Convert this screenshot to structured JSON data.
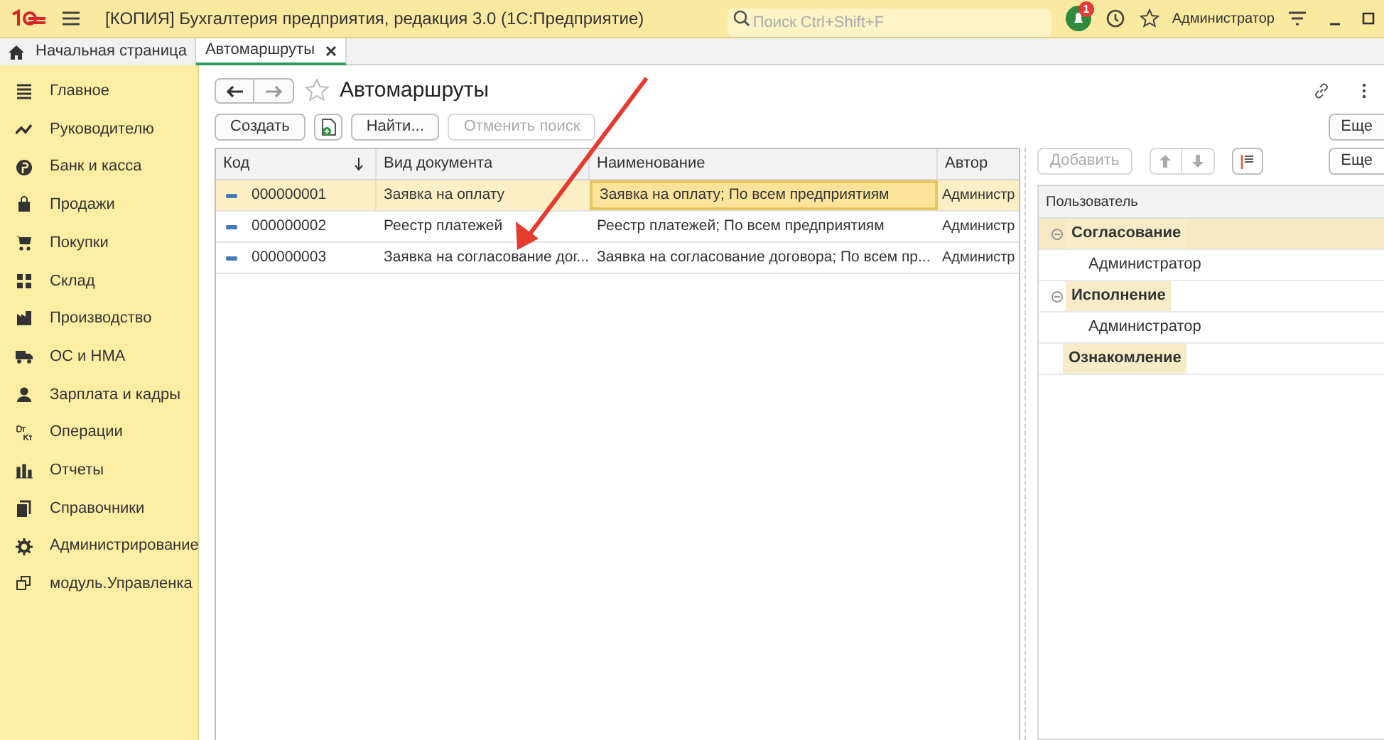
{
  "window": {
    "title": "[КОПИЯ] Бухгалтерия предприятия, редакция 3.0  (1С:Предприятие)",
    "search_placeholder": "Поиск Ctrl+Shift+F",
    "notification_count": "1",
    "user": "Администратор"
  },
  "tabs": [
    {
      "label": "Начальная страница",
      "kind": "home",
      "selected": false
    },
    {
      "label": "Автомаршруты",
      "kind": "page",
      "selected": true
    }
  ],
  "sidebar": {
    "items": [
      {
        "label": "Главное",
        "kind": "lines"
      },
      {
        "label": "Руководителю",
        "kind": "trend"
      },
      {
        "label": "Банк и касса",
        "kind": "coin"
      },
      {
        "label": "Продажи",
        "kind": "bag"
      },
      {
        "label": "Покупки",
        "kind": "cart"
      },
      {
        "label": "Склад",
        "kind": "grid"
      },
      {
        "label": "Производство",
        "kind": "factory"
      },
      {
        "label": "ОС и НМА",
        "kind": "truck"
      },
      {
        "label": "Зарплата и кадры",
        "kind": "person"
      },
      {
        "label": "Операции",
        "kind": "dtkt"
      },
      {
        "label": "Отчеты",
        "kind": "bars"
      },
      {
        "label": "Справочники",
        "kind": "books"
      },
      {
        "label": "Администрирование",
        "kind": "gear"
      },
      {
        "label": "модуль.Управленка",
        "kind": "window"
      }
    ]
  },
  "form": {
    "title": "Автомаршруты",
    "toolbar": [
      {
        "label": "Создать",
        "disabled": false
      },
      {
        "label": "Найти...",
        "disabled": false
      },
      {
        "label": "Отменить поиск",
        "disabled": true
      }
    ],
    "more_button": "Еще",
    "table": {
      "columns": [
        "Код",
        "Вид документа",
        "Наименование",
        "Автор"
      ],
      "rows": [
        {
          "cells": [
            "000000001",
            "Заявка на оплату",
            "Заявка на оплату; По всем предприятиям",
            "Администр"
          ],
          "selected": true
        },
        {
          "cells": [
            "000000002",
            "Реестр платежей",
            "Реестр платежей; По всем предприятиям",
            "Администр"
          ],
          "selected": false
        },
        {
          "cells": [
            "000000003",
            "Заявка на согласование дог...",
            "Заявка на согласование договора; По всем пр...",
            "Администр"
          ],
          "selected": false
        }
      ]
    }
  },
  "stages": {
    "add_button": {
      "label": "Добавить",
      "disabled": true
    },
    "more_button": "Еще",
    "column": "Пользователь",
    "tree": [
      {
        "label": "Согласование",
        "expanded": true,
        "selected": true,
        "children": [
          {
            "label": "Администратор"
          }
        ]
      },
      {
        "label": "Исполнение",
        "expanded": true,
        "selected": false,
        "children": [
          {
            "label": "Администратор"
          }
        ]
      },
      {
        "label": "Ознакомление",
        "selected": false
      }
    ]
  },
  "overlay": {
    "arrow": true
  }
}
